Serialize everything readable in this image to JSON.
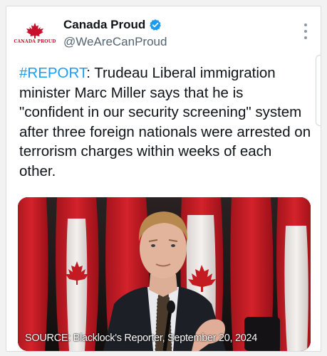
{
  "tweet": {
    "author": {
      "display_name": "Canada Proud",
      "handle": "@WeAreCanProud",
      "avatar_text": "CANADA PROUD",
      "verified": true
    },
    "more_icon": "more-vertical-icon",
    "text": {
      "hashtag": "#REPORT",
      "body": ": Trudeau Liberal immigration minister Marc Miller says that he is \"confident in our security screening\" system after three foreign nationals were arrested on terrorism charges within weeks of each other."
    },
    "media": {
      "caption": "SOURCE: Blacklock's Reporter, September 20, 2024"
    }
  },
  "colors": {
    "brand_red": "#c8102e",
    "verified_blue": "#1d9bf0",
    "hashtag_blue": "#1d9bf0",
    "text_primary": "#0f1419",
    "text_secondary": "#536471"
  }
}
